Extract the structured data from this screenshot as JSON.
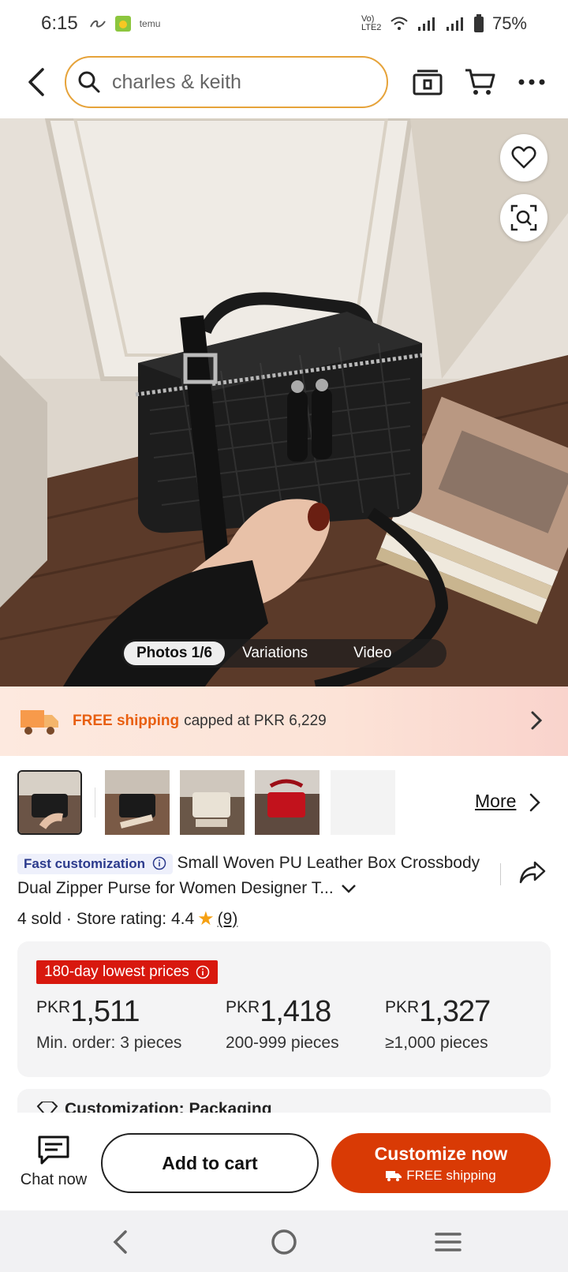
{
  "status_bar": {
    "time": "6:15",
    "network": "Vo) LTE2",
    "battery": "75%",
    "app_label": "temu"
  },
  "header": {
    "search": {
      "value": "charles & keith"
    }
  },
  "hero": {
    "tabs": [
      {
        "label": "Photos 1/6",
        "active": true
      },
      {
        "label": "Variations",
        "active": false
      },
      {
        "label": "Video",
        "active": false
      }
    ]
  },
  "shipping": {
    "free_label": "FREE shipping",
    "rest": "capped at PKR 6,229"
  },
  "thumbnails": {
    "more_label": "More",
    "items": [
      {
        "name": "black-bag-in-hand",
        "selected": true
      },
      {
        "name": "black-bag-on-wood",
        "selected": false
      },
      {
        "name": "white-bag",
        "selected": false
      },
      {
        "name": "red-bag",
        "selected": false
      },
      {
        "name": "blank",
        "selected": false
      }
    ]
  },
  "product": {
    "badge": "Fast customization",
    "title": "Small Woven PU Leather Box Crossbody Dual Zipper Purse for Women Designer T...",
    "sold": "4 sold",
    "store_rating_label": "Store rating: 4.4",
    "review_count": "(9)"
  },
  "pricing": {
    "badge": "180-day lowest prices",
    "tiers": [
      {
        "currency": "PKR",
        "amount": "1,511",
        "qty": "Min. order: 3 pieces"
      },
      {
        "currency": "PKR",
        "amount": "1,418",
        "qty": "200-999 pieces"
      },
      {
        "currency": "PKR",
        "amount": "1,327",
        "qty": "≥1,000 pieces"
      }
    ]
  },
  "customization_peek": "Customization: Packaging",
  "actions": {
    "chat": "Chat now",
    "add_to_cart": "Add to cart",
    "customize": "Customize now",
    "customize_sub": "FREE shipping"
  },
  "colors": {
    "accent": "#d93a05",
    "free_shipping": "#e85f10",
    "lowest_badge": "#d8180e",
    "search_border": "#e6a33a"
  }
}
